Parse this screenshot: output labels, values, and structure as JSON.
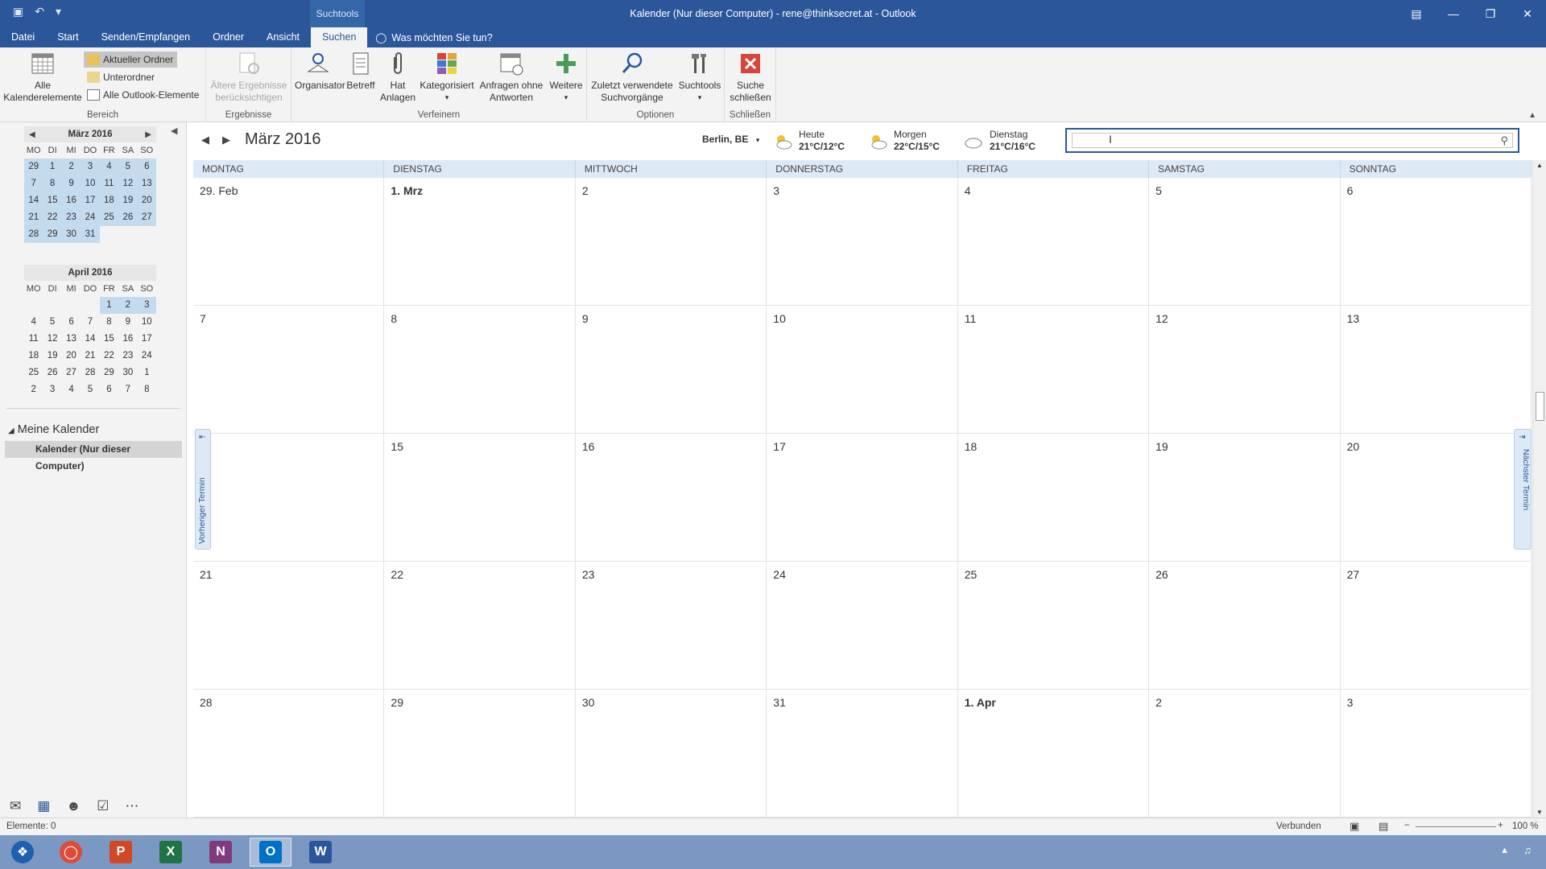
{
  "titlebar": {
    "context_tab": "Suchtools",
    "title": "Kalender (Nur dieser Computer) - rene@thinksecret.at - Outlook"
  },
  "menu": {
    "tabs": [
      "Datei",
      "Start",
      "Senden/Empfangen",
      "Ordner",
      "Ansicht",
      "Suchen"
    ],
    "active": "Suchen",
    "tellme": "Was möchten Sie tun?"
  },
  "ribbon": {
    "bereich": {
      "label": "Bereich",
      "all_calendar_items": "Alle Kalenderelemente",
      "current_folder": "Aktueller Ordner",
      "subfolders": "Unterordner",
      "all_outlook_items": "Alle Outlook-Elemente"
    },
    "ergebnisse": {
      "label": "Ergebnisse",
      "older_results": "Ältere Ergebnisse berücksichtigen"
    },
    "verfeinern": {
      "label": "Verfeinern",
      "organizer": "Organisator",
      "subject": "Betreff",
      "attachments": "Hat Anlagen",
      "categorized": "Kategorisiert",
      "requests": "Anfragen ohne Antworten",
      "more": "Weitere"
    },
    "optionen": {
      "label": "Optionen",
      "recent": "Zuletzt verwendete Suchvorgänge",
      "tools": "Suchtools"
    },
    "schliessen": {
      "label": "Schließen",
      "close_search": "Suche schließen"
    }
  },
  "minical_march": {
    "title": "März 2016",
    "dow": [
      "MO",
      "DI",
      "MI",
      "DO",
      "FR",
      "SA",
      "SO"
    ],
    "weeks": [
      [
        "29",
        "1",
        "2",
        "3",
        "4",
        "5",
        "6"
      ],
      [
        "7",
        "8",
        "9",
        "10",
        "11",
        "12",
        "13"
      ],
      [
        "14",
        "15",
        "16",
        "17",
        "18",
        "19",
        "20"
      ],
      [
        "21",
        "22",
        "23",
        "24",
        "25",
        "26",
        "27"
      ],
      [
        "28",
        "29",
        "30",
        "31",
        "",
        "",
        ""
      ]
    ]
  },
  "minical_april": {
    "title": "April 2016",
    "dow": [
      "MO",
      "DI",
      "MI",
      "DO",
      "FR",
      "SA",
      "SO"
    ],
    "weeks": [
      [
        "",
        "",
        "",
        "",
        "1",
        "2",
        "3"
      ],
      [
        "4",
        "5",
        "6",
        "7",
        "8",
        "9",
        "10"
      ],
      [
        "11",
        "12",
        "13",
        "14",
        "15",
        "16",
        "17"
      ],
      [
        "18",
        "19",
        "20",
        "21",
        "22",
        "23",
        "24"
      ],
      [
        "25",
        "26",
        "27",
        "28",
        "29",
        "30",
        "1"
      ],
      [
        "2",
        "3",
        "4",
        "5",
        "6",
        "7",
        "8"
      ]
    ]
  },
  "folders": {
    "group": "Meine Kalender",
    "item": "Kalender (Nur dieser Computer)"
  },
  "calendar": {
    "month_title": "März 2016",
    "location": "Berlin, BE",
    "weather": [
      {
        "day": "Heute",
        "temp": "21°C/12°C",
        "icon": "sun-cloud-icon"
      },
      {
        "day": "Morgen",
        "temp": "22°C/15°C",
        "icon": "sun-cloud-icon"
      },
      {
        "day": "Dienstag",
        "temp": "21°C/16°C",
        "icon": "cloud-icon"
      }
    ],
    "search_placeholder": "",
    "weekdays": [
      "MONTAG",
      "DIENSTAG",
      "MITTWOCH",
      "DONNERSTAG",
      "FREITAG",
      "SAMSTAG",
      "SONNTAG"
    ],
    "weeks": [
      [
        "29. Feb",
        "1. Mrz",
        "2",
        "3",
        "4",
        "5",
        "6"
      ],
      [
        "7",
        "8",
        "9",
        "10",
        "11",
        "12",
        "13"
      ],
      [
        "",
        "15",
        "16",
        "17",
        "18",
        "19",
        "20"
      ],
      [
        "21",
        "22",
        "23",
        "24",
        "25",
        "26",
        "27"
      ],
      [
        "28",
        "29",
        "30",
        "31",
        "1. Apr",
        "2",
        "3"
      ]
    ],
    "bold_cells": [
      "1. Mrz",
      "1. Apr"
    ],
    "prev_appointment": "Vorheriger Termin",
    "next_appointment": "Nächster Termin"
  },
  "status": {
    "items": "Elemente: 0",
    "connection": "Verbunden",
    "zoom": "100 %"
  },
  "colors": {
    "accent": "#2b579a",
    "selection": "#c4dbee",
    "close_red": "#d9443a"
  }
}
